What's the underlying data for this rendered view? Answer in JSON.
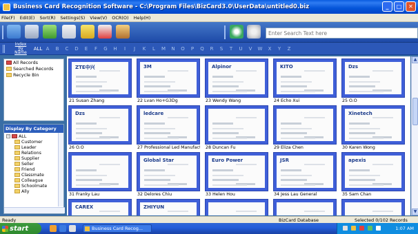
{
  "window": {
    "title": "Business Card Recognition Software - C:\\Program Files\\BizCard3.0\\UserData\\untitled0.biz",
    "minimize": "_",
    "maximize": "□",
    "close": "✕"
  },
  "menu": [
    "File(F)",
    "Edit(E)",
    "Sort(R)",
    "Settings(S)",
    "View(V)",
    "OCR(O)",
    "Help(H)"
  ],
  "toolbar": {
    "icons": [
      "scan-icon",
      "camera-icon",
      "add-user-icon",
      "import-icon",
      "export-icon",
      "delete-icon",
      "group-icon",
      "recognize-icon",
      "settings-icon"
    ],
    "search_placeholder": "Enter Search Text here"
  },
  "index_bar": {
    "label": "Index by Name",
    "label_line1": "Index by",
    "label_line2": "Name",
    "letters": [
      "ALL",
      "A",
      "B",
      "C",
      "D",
      "E",
      "F",
      "G",
      "H",
      "I",
      "J",
      "K",
      "L",
      "M",
      "N",
      "O",
      "P",
      "Q",
      "R",
      "S",
      "T",
      "U",
      "V",
      "W",
      "X",
      "Y",
      "Z"
    ]
  },
  "records_panel": {
    "items": [
      {
        "label": "All Records",
        "icon": "folder-red-icon"
      },
      {
        "label": "Searched Records",
        "icon": "folder-icon"
      },
      {
        "label": "Recycle Bin",
        "icon": "folder-icon"
      }
    ]
  },
  "category_panel": {
    "header": "Display By Category",
    "root": "ALL",
    "items": [
      "Customer",
      "Leader",
      "Relations",
      "Supplier",
      "Seller",
      "Friend",
      "Classmate",
      "Colleague",
      "Schoolmate",
      "Ally"
    ]
  },
  "cards": [
    {
      "caption": "21 Susan Zhang",
      "card_text": "ZTE中兴"
    },
    {
      "caption": "22 Lvan Ho+G3Dg",
      "card_text": "3M"
    },
    {
      "caption": "23 Wendy Wang",
      "card_text": "Alpinor"
    },
    {
      "caption": "24 Echo Xui",
      "card_text": "KITO"
    },
    {
      "caption": "25 O.O",
      "card_text": "Dzs"
    },
    {
      "caption": "26 O.O",
      "card_text": "Dzs"
    },
    {
      "caption": "27 Professional Led Manufacture",
      "card_text": "ledcare"
    },
    {
      "caption": "28 Duncan Fu",
      "card_text": ""
    },
    {
      "caption": "29 Eliza Chen",
      "card_text": ""
    },
    {
      "caption": "30 Karen Wong",
      "card_text": "Xinetech"
    },
    {
      "caption": "31 Franky Lau",
      "card_text": ""
    },
    {
      "caption": "32 Delores Chiu",
      "card_text": "Global Star"
    },
    {
      "caption": "33 Helen Hou",
      "card_text": "Euro Power"
    },
    {
      "caption": "34 Jess Lau General",
      "card_text": "JSR"
    },
    {
      "caption": "35 Sam Chan",
      "card_text": "apexis"
    },
    {
      "caption": "",
      "card_text": "CAREX"
    },
    {
      "caption": "",
      "card_text": "ZHIYUN"
    },
    {
      "caption": "",
      "card_text": ""
    },
    {
      "caption": "",
      "card_text": ""
    },
    {
      "caption": "",
      "card_text": ""
    }
  ],
  "status": {
    "left": "Ready",
    "middle": "BizCard Database",
    "right": "Selected 0/102 Records"
  },
  "taskbar": {
    "start": "start",
    "task_label": "Business Card Recog...",
    "clock": "1:07 AM"
  },
  "colors": {
    "titlebar": "#0454d8",
    "toolbar": "#2a58b8",
    "card_frame": "#3f5fd8",
    "start_button": "#2e8a2e"
  }
}
